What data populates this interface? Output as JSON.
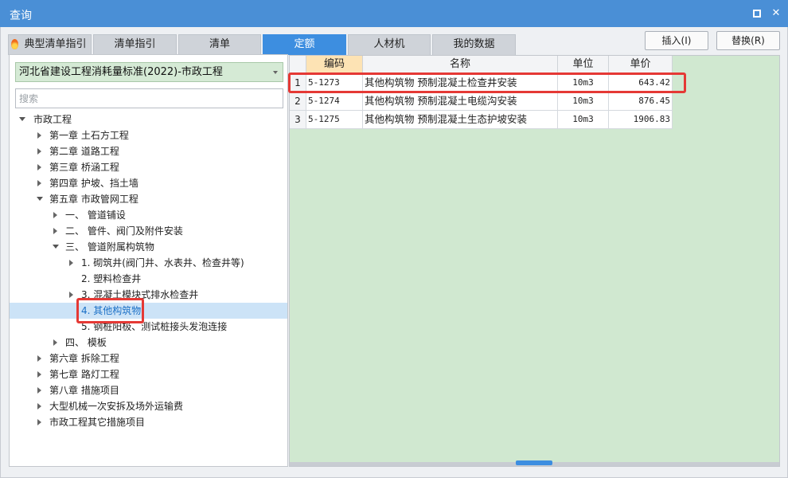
{
  "window": {
    "title": "查询",
    "maximize_icon": "maximize-icon",
    "close_icon": "close-icon",
    "close_glyph": "✕"
  },
  "tabs": [
    {
      "label": "典型清单指引",
      "icon": "fire-icon",
      "active": false
    },
    {
      "label": "清单指引",
      "active": false
    },
    {
      "label": "清单",
      "active": false
    },
    {
      "label": "定额",
      "active": true
    },
    {
      "label": "人材机",
      "active": false
    },
    {
      "label": "我的数据",
      "active": false
    }
  ],
  "actions": {
    "insert_label": "插入(I)",
    "replace_label": "替换(R)"
  },
  "left": {
    "library_selected": "河北省建设工程消耗量标准(2022)-市政工程",
    "search_placeholder": "搜索",
    "tree": [
      {
        "label": "市政工程",
        "expanded": true
      },
      {
        "label": "第一章 土石方工程"
      },
      {
        "label": "第二章 道路工程"
      },
      {
        "label": "第三章 桥涵工程"
      },
      {
        "label": "第四章 护坡、挡土墙"
      },
      {
        "label": "第五章 市政管网工程",
        "expanded": true
      },
      {
        "label": "一、 管道铺设"
      },
      {
        "label": "二、 管件、阀门及附件安装"
      },
      {
        "label": "三、 管道附属构筑物",
        "expanded": true
      },
      {
        "label": "1. 砌筑井(阀门井、水表井、检查井等)"
      },
      {
        "label": "2. 塑料检查井"
      },
      {
        "label": "3. 混凝土模块式排水检查井"
      },
      {
        "label": "4. 其他构筑物",
        "selected": true
      },
      {
        "label": "5. 钢桩阳极、测试桩接头发泡连接"
      },
      {
        "label": "四、 模板"
      },
      {
        "label": "第六章 拆除工程"
      },
      {
        "label": "第七章 路灯工程"
      },
      {
        "label": "第八章 措施项目"
      },
      {
        "label": "大型机械一次安拆及场外运输费"
      },
      {
        "label": "市政工程其它措施项目"
      }
    ]
  },
  "grid": {
    "columns": [
      "编码",
      "名称",
      "单位",
      "单价"
    ],
    "rows": [
      {
        "index": "1",
        "code": "5-1273",
        "name": "其他构筑物 预制混凝土检查井安装",
        "unit": "10m3",
        "price": "643.42"
      },
      {
        "index": "2",
        "code": "5-1274",
        "name": "其他构筑物 预制混凝土电缆沟安装",
        "unit": "10m3",
        "price": "876.45"
      },
      {
        "index": "3",
        "code": "5-1275",
        "name": "其他构筑物 预制混凝土生态护坡安装",
        "unit": "10m3",
        "price": "1906.83"
      }
    ]
  },
  "colors": {
    "title_bar": "#4a8fd6",
    "active_tab": "#3d8ee0",
    "highlight": "#e53935",
    "grid_bg": "#d0e8d0"
  }
}
